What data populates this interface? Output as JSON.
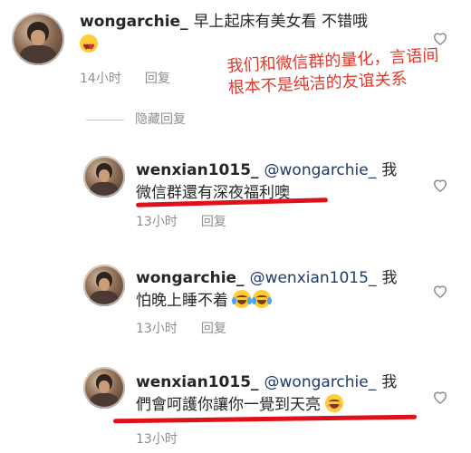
{
  "comments": [
    {
      "username": "wongarchie_",
      "mention": "",
      "line1": "早上起床有美女看 不错哦",
      "line2": "",
      "time": "14小时",
      "reply": "回复"
    },
    {
      "username": "wenxian1015_",
      "mention": "@wongarchie_",
      "line1": "我",
      "line2": "微信群還有深夜福利噢",
      "time": "13小时",
      "reply": "回复"
    },
    {
      "username": "wongarchie_",
      "mention": "@wenxian1015_",
      "line1": "我",
      "line2": "怕晚上睡不着",
      "time": "13小时",
      "reply": "回复"
    },
    {
      "username": "wenxian1015_",
      "mention": "@wongarchie_",
      "line1": "我",
      "line2": "們會呵護你讓你一覺到天亮",
      "time": "13小时",
      "reply": ""
    }
  ],
  "hidden_replies": "隐藏回复",
  "annotation": "我们和微信群的量化，言语间根本不是纯洁的友谊关系",
  "colors": {
    "annotation": "#e0392b",
    "underline": "#e0101a",
    "meta": "#8e8e8e"
  },
  "icons": {
    "like": "heart-outline-icon"
  }
}
